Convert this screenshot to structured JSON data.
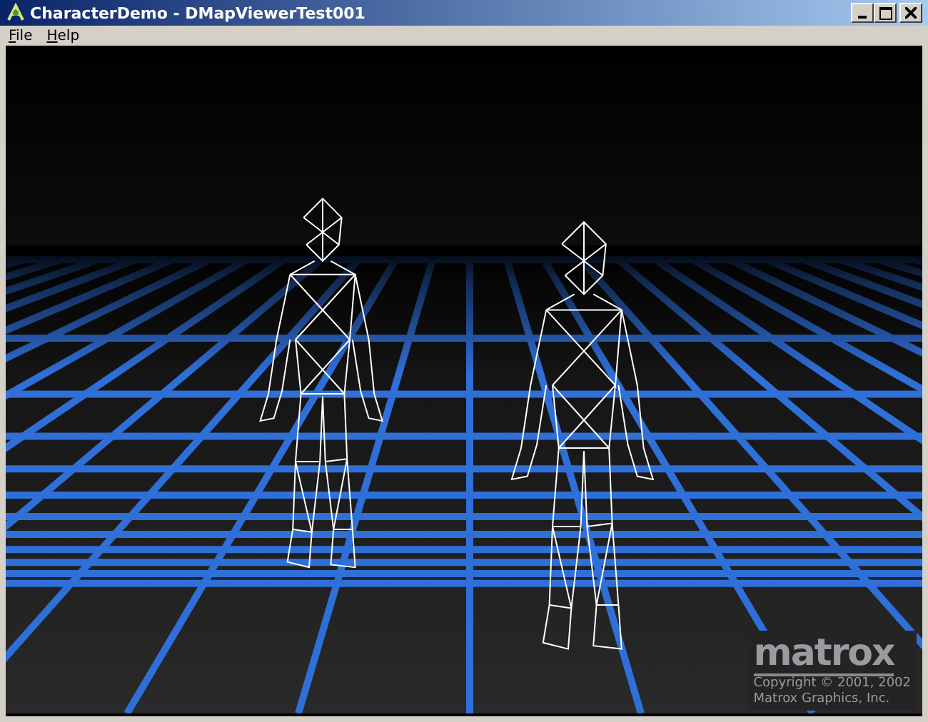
{
  "window": {
    "title": "CharacterDemo - DMapViewerTest001"
  },
  "menu": [
    "File",
    "Help"
  ],
  "viewport": {
    "logo": "matrox",
    "copyright": [
      "Copyright © 2001, 2002",
      "Matrox Graphics, Inc."
    ]
  }
}
